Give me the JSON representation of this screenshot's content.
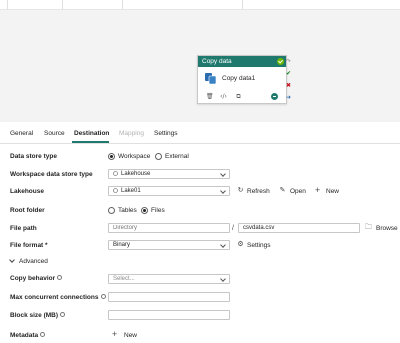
{
  "canvas": {
    "activity": {
      "header": "Copy data",
      "name": "Copy data1",
      "accent_color": "#1f7a6d"
    }
  },
  "tabs": [
    {
      "label": "General"
    },
    {
      "label": "Source"
    },
    {
      "label": "Destination"
    },
    {
      "label": "Mapping"
    },
    {
      "label": "Settings"
    }
  ],
  "form": {
    "data_store_type": {
      "label": "Data store type",
      "options": [
        "Workspace",
        "External"
      ],
      "selected": "Workspace"
    },
    "workspace_data_store_type": {
      "label": "Workspace data store type",
      "value": "Lakehouse"
    },
    "lakehouse": {
      "label": "Lakehouse",
      "value": "Lake01",
      "refresh": "Refresh",
      "open": "Open",
      "new": "New"
    },
    "root_folder": {
      "label": "Root folder",
      "options": [
        "Tables",
        "Files"
      ],
      "selected": "Files"
    },
    "file_path": {
      "label": "File path",
      "directory_placeholder": "Directory",
      "separator": "/",
      "filename": "csvdata.csv",
      "browse": "Browse"
    },
    "file_format": {
      "label": "File format *",
      "value": "Binary",
      "settings": "Settings"
    },
    "advanced": {
      "label": "Advanced"
    },
    "copy_behavior": {
      "label": "Copy behavior",
      "placeholder": "Select..."
    },
    "max_concurrent_connections": {
      "label": "Max concurrent connections"
    },
    "block_size": {
      "label": "Block size (MB)"
    },
    "metadata": {
      "label": "Metadata",
      "new": "New"
    }
  }
}
